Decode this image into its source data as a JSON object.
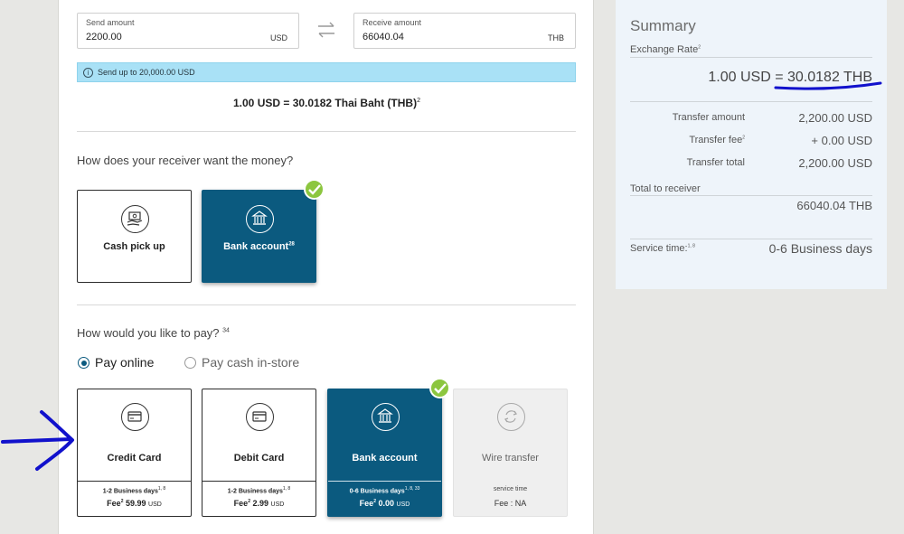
{
  "send": {
    "label": "Send amount",
    "value": "2200.00",
    "currency": "USD"
  },
  "receive": {
    "label": "Receive amount",
    "value": "66040.04",
    "currency": "THB"
  },
  "info_bar": {
    "text": "Send up to 20,000.00 USD"
  },
  "rate_line": {
    "text": "1.00 USD = 30.0182 Thai Baht (THB)",
    "sup": "2"
  },
  "receive_method": {
    "question": "How does your receiver want the money?",
    "options": [
      {
        "label": "Cash pick up",
        "sup": "",
        "icon": "cash-hand-icon",
        "selected": false
      },
      {
        "label": "Bank account",
        "sup": "28",
        "icon": "bank-icon",
        "selected": true
      }
    ]
  },
  "pay_method": {
    "question": "How would you like to pay?",
    "question_sup": "34",
    "radios": [
      {
        "label": "Pay online",
        "checked": true
      },
      {
        "label": "Pay cash in-store",
        "checked": false
      }
    ],
    "options": [
      {
        "label": "Credit Card",
        "icon": "credit-card-icon",
        "time": "1-2 Business days",
        "time_sup": "1, 8",
        "fee_label": "Fee",
        "fee_sup": "2",
        "fee_value": "59.99",
        "fee_cur": "USD",
        "state": "normal"
      },
      {
        "label": "Debit Card",
        "icon": "debit-card-icon",
        "time": "1-2 Business days",
        "time_sup": "1, 8",
        "fee_label": "Fee",
        "fee_sup": "2",
        "fee_value": "2.99",
        "fee_cur": "USD",
        "state": "normal"
      },
      {
        "label": "Bank account",
        "icon": "bank-icon",
        "time": "0-6 Business days",
        "time_sup": "1, 8, 33",
        "fee_label": "Fee",
        "fee_sup": "2",
        "fee_value": "0.00",
        "fee_cur": "USD",
        "state": "selected"
      },
      {
        "label": "Wire transfer",
        "icon": "wire-transfer-icon",
        "time": "service time",
        "fee_text": "Fee : NA",
        "state": "disabled"
      }
    ]
  },
  "summary": {
    "title": "Summary",
    "exchange_rate_label": "Exchange Rate",
    "exchange_rate_sup": "2",
    "rate_left": "1.00 USD = ",
    "rate_right": "30.0182 THB",
    "transfer_amount_label": "Transfer amount",
    "transfer_amount": "2,200.00 USD",
    "transfer_fee_label": "Transfer fee",
    "transfer_fee_sup": "2",
    "transfer_fee": "+ 0.00 USD",
    "transfer_total_label": "Transfer total",
    "transfer_total": "2,200.00 USD",
    "total_receiver_label": "Total  to receiver",
    "total_receiver": "66040.04 THB",
    "service_time_label": "Service time:",
    "service_time_sup": "1, 8",
    "service_time": "0-6 Business days"
  },
  "colors": {
    "selected": "#0b5a7f",
    "check": "#8cc63f",
    "info": "#a9e1f6",
    "annotation": "#1111cc"
  }
}
